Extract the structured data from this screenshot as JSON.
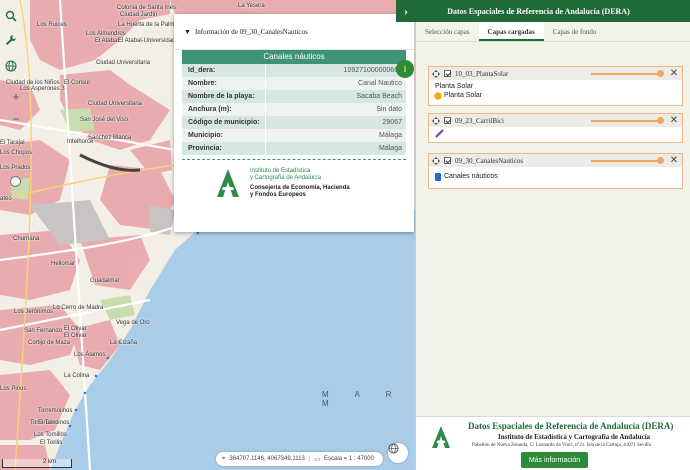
{
  "map": {
    "place_labels": [
      {
        "text": "La Yesera",
        "cls": "l1"
      },
      {
        "text": "Colonia de Santa Inés",
        "cls": "l2"
      },
      {
        "text": "Ciudad Jardín",
        "cls": "l3"
      },
      {
        "text": "La Huerta de la Palma",
        "cls": "l4"
      },
      {
        "text": "Los Ruices",
        "cls": "l5"
      },
      {
        "text": "Los Almendros",
        "cls": "l6"
      },
      {
        "text": "El Atabal",
        "cls": "l7"
      },
      {
        "text": "El Atabal-Universidad",
        "cls": "l8"
      },
      {
        "text": "Ciudad Universitaria",
        "cls": "l9"
      },
      {
        "text": "El Consul",
        "cls": "l10"
      },
      {
        "text": "Ciudad de los Niños",
        "cls": "l11"
      },
      {
        "text": "Los Asperones 3",
        "cls": "l12"
      },
      {
        "text": "San José del Viso",
        "cls": "l13"
      },
      {
        "text": "Ciudad Universitaria",
        "cls": "l14"
      },
      {
        "text": "Sánchez Blanca",
        "cls": "l15"
      },
      {
        "text": "Intelhorce",
        "cls": "l16"
      },
      {
        "text": "El Tarajal",
        "cls": "l17"
      },
      {
        "text": "Los Prados",
        "cls": "l18"
      },
      {
        "text": "Churriana",
        "cls": "l19"
      },
      {
        "text": "Heliomar",
        "cls": "l20"
      },
      {
        "text": "Los Jerónimos",
        "cls": "l21"
      },
      {
        "text": "Guadalmar",
        "cls": "l22"
      },
      {
        "text": "San Fernando",
        "cls": "l23"
      },
      {
        "text": "Cortijo de Maza",
        "cls": "l24"
      },
      {
        "text": "Los Álamos",
        "cls": "l25"
      },
      {
        "text": "La Colina",
        "cls": "l26"
      },
      {
        "text": "Torremolinos",
        "cls": "l27"
      },
      {
        "text": "Lo Cerro de Madra",
        "cls": "l28"
      },
      {
        "text": "Vega de Oro",
        "cls": "l29"
      },
      {
        "text": "El Olivar",
        "cls": "l30"
      },
      {
        "text": "El Olivar",
        "cls": "l31"
      },
      {
        "text": "La Cizaña",
        "cls": "l32"
      },
      {
        "text": "Los Pinos",
        "cls": "l33"
      },
      {
        "text": "Torrenabelinos",
        "cls": "l34"
      },
      {
        "text": "Los Tomillos",
        "cls": "l35"
      },
      {
        "text": "El Torilis",
        "cls": "l36"
      },
      {
        "text": "El Torro",
        "cls": "l37"
      },
      {
        "text": "ateo",
        "cls": "l38"
      },
      {
        "text": "Los Chopos",
        "cls": "l39"
      }
    ],
    "sea_label": "M A R   M",
    "scale_text": "2 km",
    "coordinates": "364707.1146, 4067349.1113",
    "scale": "Escala = 1 : 47000"
  },
  "info": {
    "header": "Información de 09_30_CanalesNauticos",
    "title": "Canales náuticos",
    "rows": [
      {
        "key": "Id_dera:",
        "value": "109271000000660"
      },
      {
        "key": "Nombre:",
        "value": "Canal Nautico"
      },
      {
        "key": "Nombre de la playa:",
        "value": "Sacaba Beach"
      },
      {
        "key": "Anchura (m):",
        "value": "Sin dato"
      },
      {
        "key": "Código de municipio:",
        "value": "29067"
      },
      {
        "key": "Municipio:",
        "value": "Málaga"
      },
      {
        "key": "Provincia:",
        "value": "Málaga"
      }
    ],
    "ieca_line1": "Instituto de Estadística",
    "ieca_line2": "y Cartografía de Andalucía",
    "cons_line1": "Consejería de Economía, Hacienda",
    "cons_line2": "y Fondos Europeos",
    "tab_icon": "i"
  },
  "panel": {
    "title": "Datos Espaciales de Referencia de Andalucía (DERA)",
    "tabs": [
      "Selección capas",
      "Capas cargadas",
      "Capas de fondo"
    ],
    "active_tab": "Capas cargadas",
    "layers": [
      {
        "name": "10_03_PlantaSolar",
        "legend": [
          "Planta Solar",
          "Planta Solar"
        ]
      },
      {
        "name": "09_23_CarrilBici",
        "legend": []
      },
      {
        "name": "09_30_CanalesNauticos",
        "legend": [
          "Canales náuticos"
        ]
      }
    ],
    "brand_title": "Datos Espaciales de Referencia de Andalucía (DERA)",
    "brand_sub": "Instituto de Estadística y Cartografía de Andalucía",
    "brand_addr": "Pabellón de Nueva Zelanda, C/ Leonardo da Vinci, nº21. Isla de la Cartuja, 41071 Sevilla",
    "more_info": "Más información"
  },
  "colors": {
    "accent_green": "#1e6b38",
    "table_green": "#3e9277",
    "sea": "#a9cde9",
    "urban": "#e8a5a8",
    "land": "#f4efe6"
  }
}
